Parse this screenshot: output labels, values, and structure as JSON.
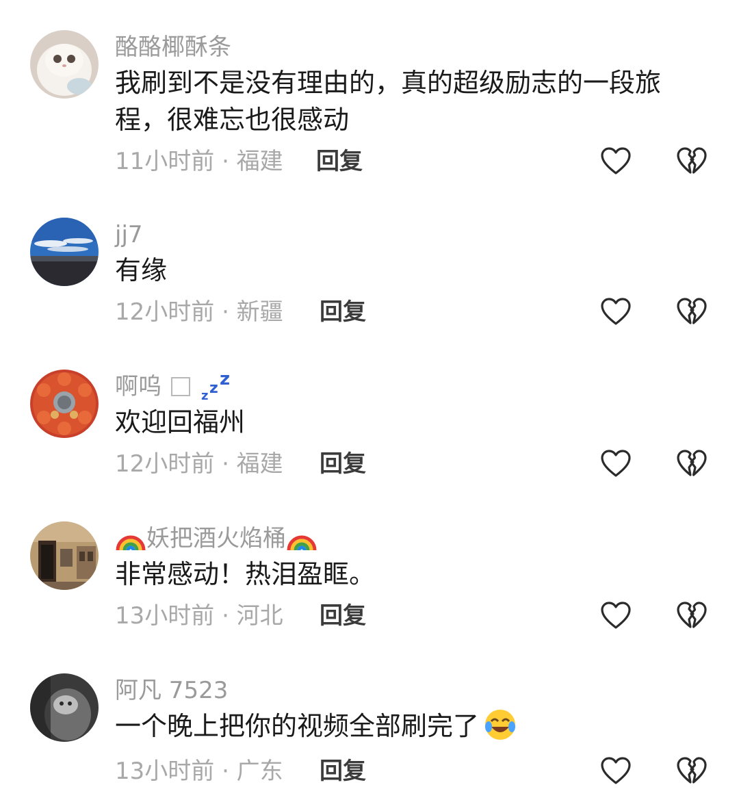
{
  "comments": [
    {
      "username": "酪酪椰酥条",
      "text": "我刷到不是没有理由的，真的超级励志的一段旅程，很难忘也很感动",
      "meta": "11小时前 · 福建",
      "reply": "回复",
      "avatar_icon": "white-kitten-avatar",
      "like_icon": "heart-outline-icon",
      "dislike_icon": "broken-heart-icon"
    },
    {
      "username": "jj7",
      "text": "有缘",
      "meta": "12小时前 · 新疆",
      "reply": "回复",
      "avatar_icon": "blue-sky-landscape-avatar",
      "like_icon": "heart-outline-icon",
      "dislike_icon": "broken-heart-icon"
    },
    {
      "username": "啊呜",
      "badge_icons": [
        "square-icon",
        "zzz-sleep-icon"
      ],
      "text": "欢迎回福州",
      "meta": "12小时前 · 福建",
      "reply": "回复",
      "avatar_icon": "food-platter-avatar",
      "like_icon": "heart-outline-icon",
      "dislike_icon": "broken-heart-icon"
    },
    {
      "username": "妖把酒火焰桶",
      "username_decor_icon": "rainbow-emoji",
      "text": "非常感动！热泪盈眶。",
      "meta": "13小时前 · 河北",
      "reply": "回复",
      "avatar_icon": "old-building-avatar",
      "like_icon": "heart-outline-icon",
      "dislike_icon": "broken-heart-icon"
    },
    {
      "username": "阿凡 7523",
      "text": "一个晚上把你的视频全部刷完了",
      "text_emoji_icon": "tears-of-joy-emoji",
      "meta": "13小时前 · 广东",
      "reply": "回复",
      "avatar_icon": "grayscale-photo-avatar",
      "like_icon": "heart-outline-icon",
      "dislike_icon": "broken-heart-icon"
    }
  ],
  "colors": {
    "username": "#9a9a9a",
    "text": "#1a1a1a",
    "meta": "#a8a8a8",
    "reply": "#3b3b3b",
    "icon_stroke": "#2b2b2b",
    "zzz": "#2f5fd0"
  }
}
